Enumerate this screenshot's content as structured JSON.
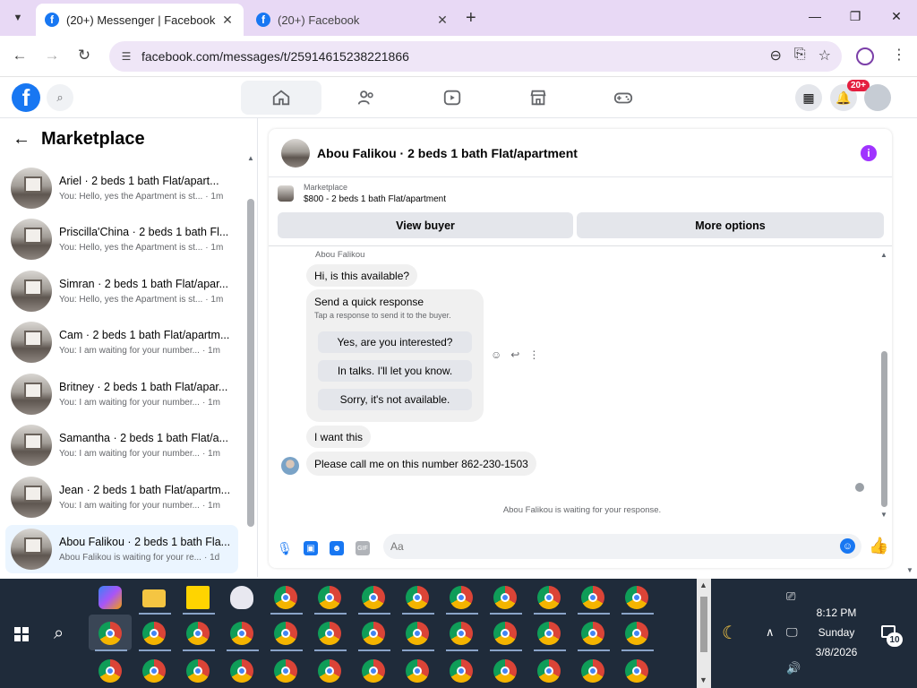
{
  "browser": {
    "tabs": [
      {
        "title": "(20+) Messenger | Facebook",
        "active": true
      },
      {
        "title": "(20+) Facebook",
        "active": false
      }
    ],
    "new_tab_label": "+",
    "url": "facebook.com/messages/t/25914615238221866"
  },
  "fb": {
    "logo": "f",
    "notification_badge": "20+"
  },
  "left_panel": {
    "title": "Marketplace",
    "conversations": [
      {
        "name": "Ariel · 2 beds 1 bath Flat/apart...",
        "preview": "You: Hello, yes the Apartment is st...",
        "time": "· 1m"
      },
      {
        "name": "Priscilla'China · 2 beds 1 bath Fl...",
        "preview": "You: Hello, yes the Apartment is st...",
        "time": "· 1m"
      },
      {
        "name": "Simran · 2 beds 1 bath Flat/apar...",
        "preview": "You: Hello, yes the Apartment is st...",
        "time": "· 1m"
      },
      {
        "name": "Cam · 2 beds 1 bath Flat/apartm...",
        "preview": "You: I am waiting for your number...",
        "time": "· 1m"
      },
      {
        "name": "Britney · 2 beds 1 bath Flat/apar...",
        "preview": "You: I am waiting for your number...",
        "time": "· 1m"
      },
      {
        "name": "Samantha · 2 beds 1 bath Flat/a...",
        "preview": "You: I am waiting for your number...",
        "time": "· 1m"
      },
      {
        "name": "Jean · 2 beds 1 bath Flat/apartm...",
        "preview": "You: I am waiting for your number...",
        "time": "· 1m"
      },
      {
        "name": "Abou Falikou · 2 beds 1 bath Fla...",
        "preview": "Abou Falikou is waiting for your re...",
        "time": "· 1d"
      }
    ]
  },
  "chat": {
    "title": "Abou Falikou · 2 beds 1 bath Flat/apartment",
    "marketplace_label": "Marketplace",
    "listing": "$800 - 2 beds 1 bath Flat/apartment",
    "view_buyer": "View buyer",
    "more_options": "More options",
    "sender": "Abou Falikou",
    "message1": "Hi, is this available?",
    "quick_response_title": "Send a quick response",
    "quick_response_sub": "Tap a response to send it to the buyer.",
    "quick_options": [
      "Yes, are you interested?",
      "In talks. I'll let you know.",
      "Sorry, it's not available."
    ],
    "message2": "I want this",
    "message3": "Please call me on this number 862-230-1503",
    "waiting_note": "Abou Falikou is waiting for your response.",
    "input_placeholder": "Aa"
  },
  "taskbar": {
    "time": "8:12 PM",
    "day": "Sunday",
    "date": "3/8/2026",
    "notifications_count": "10"
  }
}
